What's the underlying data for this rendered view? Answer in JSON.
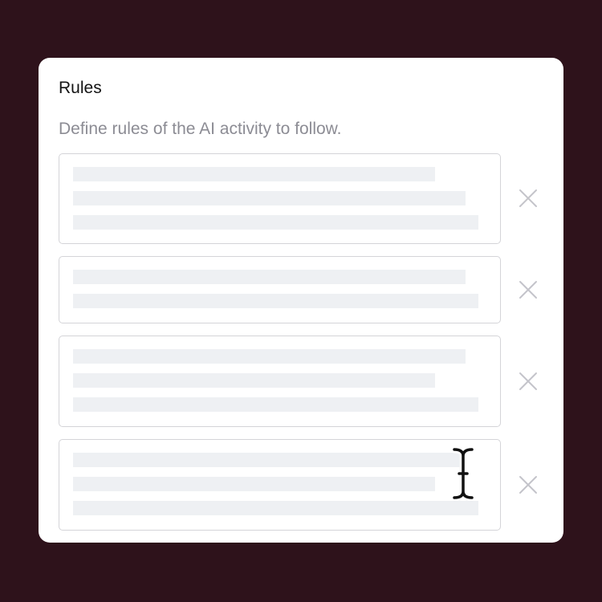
{
  "panel": {
    "title": "Rules",
    "subtitle": "Define rules of the AI activity to follow."
  },
  "rules": [
    {
      "line_count": 3,
      "delete_icon": "close-icon"
    },
    {
      "line_count": 2,
      "delete_icon": "close-icon"
    },
    {
      "line_count": 3,
      "delete_icon": "close-icon"
    },
    {
      "line_count": 3,
      "delete_icon": "close-icon"
    }
  ],
  "cursor": {
    "icon": "text-cursor-icon"
  },
  "colors": {
    "background": "#2e121b",
    "card": "#ffffff",
    "placeholder_line": "#eef0f3",
    "border": "#d4d4d8",
    "close_icon": "#c4c4ca"
  }
}
